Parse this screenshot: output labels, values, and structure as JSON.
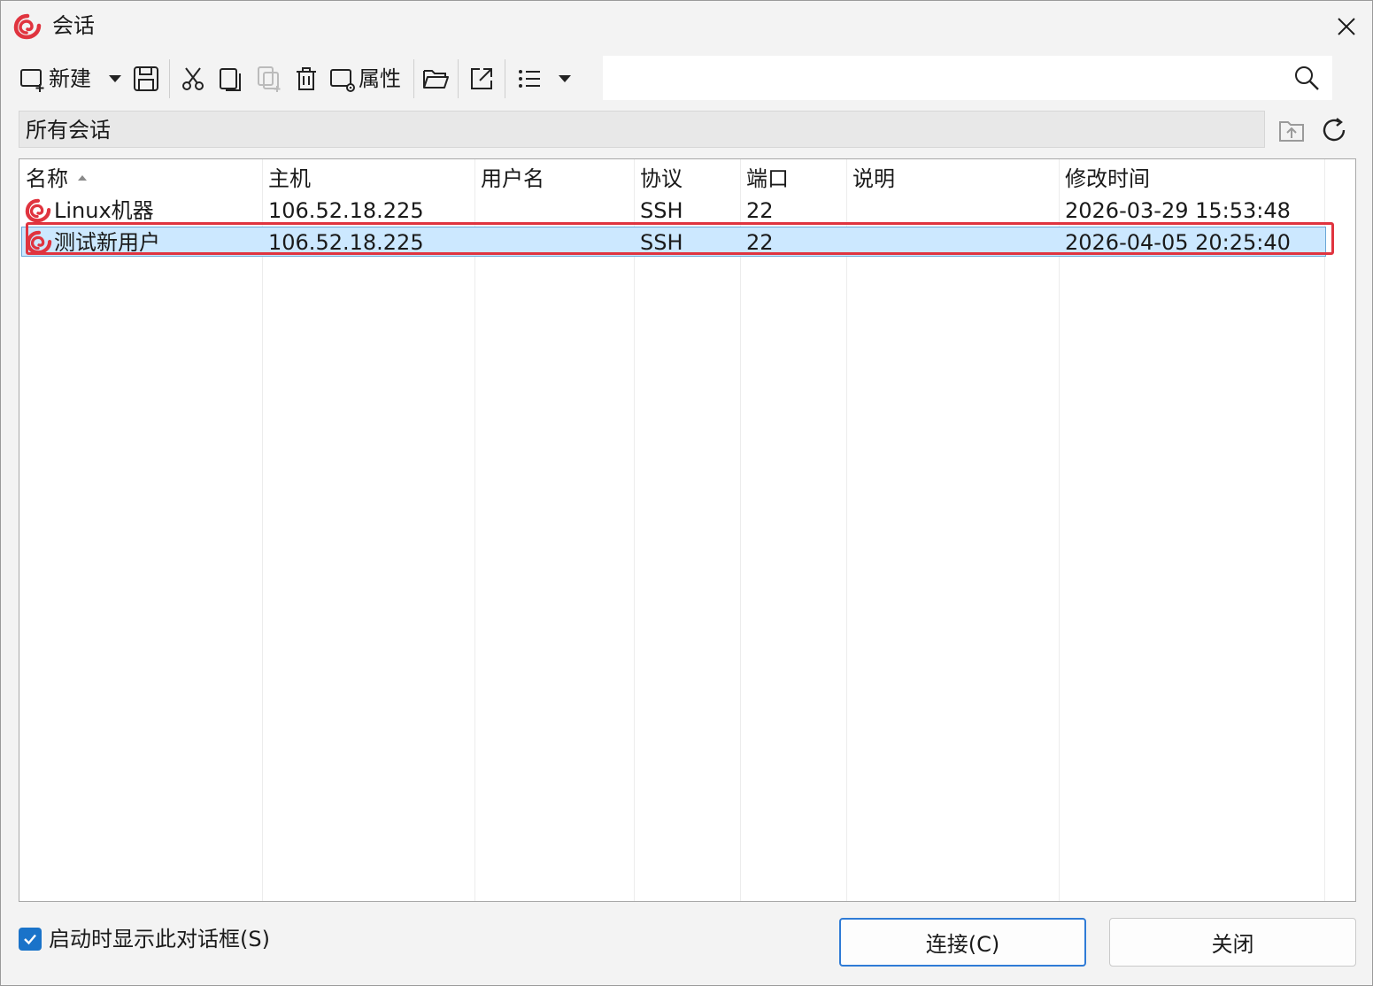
{
  "window": {
    "title": "会话"
  },
  "toolbar": {
    "new_label": "新建",
    "properties_label": "属性"
  },
  "search": {
    "placeholder": "",
    "value": ""
  },
  "path": {
    "label": "所有会话"
  },
  "table": {
    "columns": [
      "名称",
      "主机",
      "用户名",
      "协议",
      "端口",
      "说明",
      "修改时间"
    ],
    "sort_column": "名称",
    "rows": [
      {
        "name": "Linux机器",
        "host": "106.52.18.225",
        "user": "",
        "protocol": "SSH",
        "port": "22",
        "desc": "",
        "modified": "2026-03-29 15:53:48",
        "selected": false
      },
      {
        "name": "测试新用户",
        "host": "106.52.18.225",
        "user": "",
        "protocol": "SSH",
        "port": "22",
        "desc": "",
        "modified": "2026-04-05 20:25:40",
        "selected": true
      }
    ]
  },
  "footer": {
    "show_on_startup_label": "启动时显示此对话框(S)",
    "show_on_startup_checked": true,
    "connect_label": "连接(C)",
    "close_label": "关闭"
  },
  "colors": {
    "brand": "#e0343f",
    "selection_bg": "#cce8ff",
    "accent": "#1a73c9",
    "highlight_outline": "#e0343f"
  },
  "icons": {
    "app": "swirl-logo-icon",
    "new": "new-session-icon",
    "save": "save-icon",
    "cut": "cut-icon",
    "copy": "copy-icon",
    "paste": "paste-icon",
    "delete": "trash-icon",
    "properties": "properties-icon",
    "open": "open-folder-icon",
    "export": "export-icon",
    "view": "list-view-icon",
    "search": "search-icon",
    "up": "up-folder-icon",
    "refresh": "refresh-icon",
    "close": "close-icon"
  }
}
